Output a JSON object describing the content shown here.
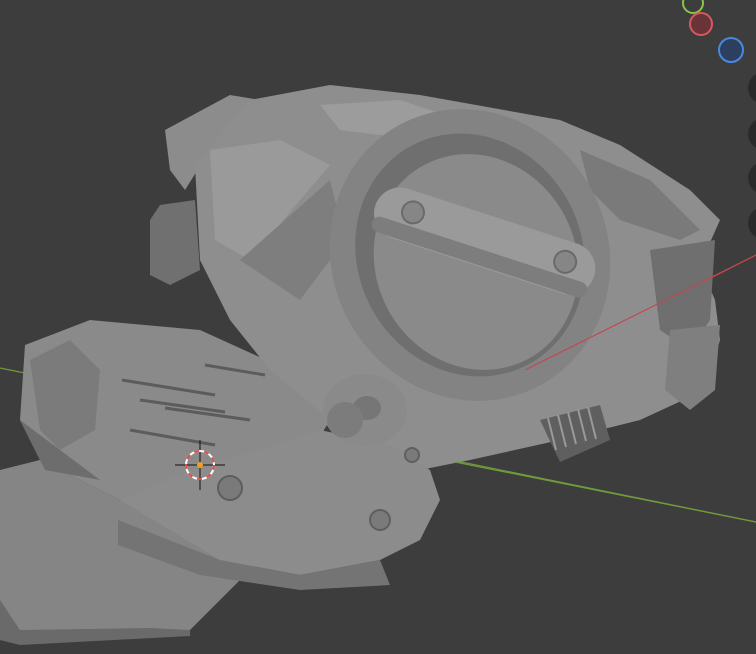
{
  "app": {
    "name": "",
    "view": "3D Viewport"
  },
  "scene": {
    "object": "mechanical-part",
    "shading": "solid",
    "colors": {
      "background": "#3d3d3d",
      "mesh_light": "#8f8f8f",
      "mesh_mid": "#7a7a7a",
      "mesh_dark": "#5e5e5e",
      "x_axis": "#c0474e",
      "y_axis": "#6f9b3d",
      "cursor_red": "#e24a4a",
      "origin": "#f0a020"
    }
  },
  "gizmo": {
    "axes": [
      "x",
      "y",
      "z"
    ],
    "colors": {
      "x": "#d45a5f",
      "y": "#8bc34a",
      "z": "#4a88e0"
    }
  },
  "nav_buttons": [
    "zoom-icon",
    "pan-icon",
    "camera-icon",
    "perspective-icon"
  ]
}
